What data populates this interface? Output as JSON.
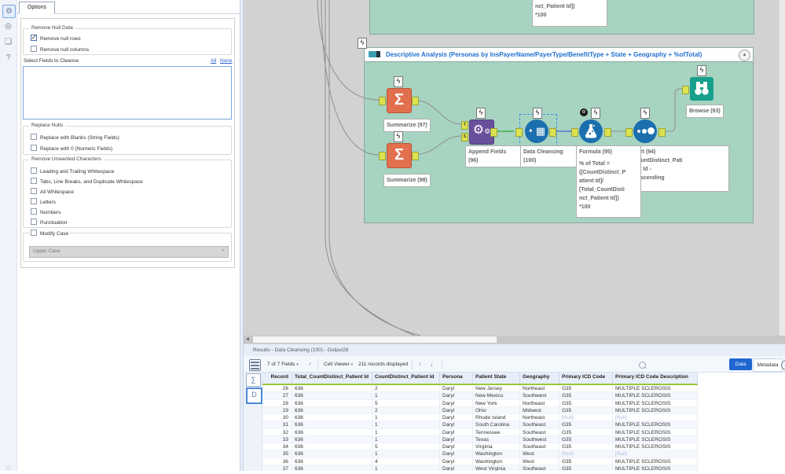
{
  "config": {
    "tab_label": "Options",
    "icons": [
      "gear-icon",
      "canvas-icon",
      "tag-icon",
      "help-icon"
    ],
    "remove_null": {
      "legend": "Remove Null Data",
      "items": [
        {
          "label": "Remove null rows",
          "checked": true
        },
        {
          "label": "Remove null columns",
          "checked": false
        }
      ]
    },
    "select_fields": {
      "label": "Select Fields to Cleanse",
      "link_all": "All",
      "link_none": "None"
    },
    "replace_nulls": {
      "legend": "Replace Nulls",
      "items": [
        {
          "label": "Replace with Blanks (String Fields)",
          "checked": false
        },
        {
          "label": "Replace with 0 (Numeric Fields)",
          "checked": false
        }
      ]
    },
    "remove_unwanted": {
      "legend": "Remove Unwanted Characters",
      "items": [
        {
          "label": "Leading and Trailing Whitespace",
          "checked": false
        },
        {
          "label": "Tabs, Line Breaks, and Duplicate Whitespace",
          "checked": false
        },
        {
          "label": "All Whitespace",
          "checked": false
        },
        {
          "label": "Letters",
          "checked": false
        },
        {
          "label": "Numbers",
          "checked": false
        },
        {
          "label": "Punctuation",
          "checked": false
        }
      ]
    },
    "modify_case": {
      "label": "Modify Case",
      "checked": false,
      "select_value": "Upper Case"
    }
  },
  "canvas": {
    "top_annotation": {
      "line1": "nct_Patient Id])",
      "line2": "*100"
    },
    "container_title": "Descriptive Analysis (Personas by InsPayerName/PayerType/BenefitType + State + Geography + %ofTotal)",
    "collapse_glyph": "▴",
    "tools": {
      "summarize97": "Summarize (97)",
      "summarize98": "Summarize (98)",
      "append_l1": "Append Fields",
      "append_l2": "(96)",
      "cleansing_l1": "Data Cleansing",
      "cleansing_l2": "(100)",
      "formula_title": "Formula (95)",
      "formula_lines": [
        "% of Total =",
        "([CountDistinct_P",
        "atient Id]/",
        "[Total_CountDisti",
        "nct_Patient Id])",
        "*100"
      ],
      "sort_lines": [
        "Sort (94)",
        "CountDistinct_Pati",
        "ent Id -",
        "Descending"
      ],
      "browse": "Browse (93)"
    },
    "anchor_letters": {
      "t": "T",
      "s": "S"
    },
    "colors": {
      "container_green": "#a7d3c1",
      "summarize_orange": "#e2704e",
      "append_purple": "#6a4f9b",
      "tool_blue": "#1b6fae",
      "browse_teal": "#17a08c",
      "wire_green": "#3fae49",
      "wire_blue": "#5577cc"
    }
  },
  "results": {
    "title": "Results - Data Cleansing (100) - Output26",
    "toolbar": {
      "fields": "7 of 7 Fields",
      "cell_viewer": "Cell Viewer",
      "records": "211 records displayed",
      "data_btn": "Data",
      "metadata_btn": "Metadata"
    },
    "table": {
      "headers": [
        "Record",
        "Total_CountDistinct_Patient Id",
        "CountDistinct_Patient Id",
        "Persona",
        "Patient State",
        "Geography",
        "Primary ICD Code",
        "Primary ICD Code Description"
      ],
      "rows": [
        [
          "26",
          "636",
          "2",
          "Daryl",
          "New Jersey",
          "Northeast",
          "G35",
          "MULTIPLE SCLEROSIS"
        ],
        [
          "27",
          "636",
          "1",
          "Daryl",
          "New Mexico",
          "Southwest",
          "G35",
          "MULTIPLE SCLEROSIS"
        ],
        [
          "28",
          "636",
          "5",
          "Daryl",
          "New York",
          "Northeast",
          "G35",
          "MULTIPLE SCLEROSIS"
        ],
        [
          "29",
          "636",
          "2",
          "Daryl",
          "Ohio",
          "Midwest",
          "G35",
          "MULTIPLE SCLEROSIS"
        ],
        [
          "30",
          "636",
          "1",
          "Daryl",
          "Rhode Island",
          "Northeast",
          "[Null]",
          "[Null]"
        ],
        [
          "31",
          "636",
          "1",
          "Daryl",
          "South Carolina",
          "Southeast",
          "G35",
          "MULTIPLE SCLEROSIS"
        ],
        [
          "32",
          "636",
          "1",
          "Daryl",
          "Tennessee",
          "Southeast",
          "G35",
          "MULTIPLE SCLEROSIS"
        ],
        [
          "33",
          "636",
          "1",
          "Daryl",
          "Texas",
          "Southwest",
          "G35",
          "MULTIPLE SCLEROSIS"
        ],
        [
          "34",
          "636",
          "5",
          "Daryl",
          "Virginia",
          "Southeast",
          "G35",
          "MULTIPLE SCLEROSIS"
        ],
        [
          "35",
          "636",
          "1",
          "Daryl",
          "Washington",
          "West",
          "[Null]",
          "[Null]"
        ],
        [
          "36",
          "636",
          "4",
          "Daryl",
          "Washington",
          "West",
          "G35",
          "MULTIPLE SCLEROSIS"
        ],
        [
          "37",
          "636",
          "1",
          "Daryl",
          "West Virginia",
          "Southeast",
          "G35",
          "MULTIPLE SCLEROSIS"
        ]
      ]
    }
  }
}
